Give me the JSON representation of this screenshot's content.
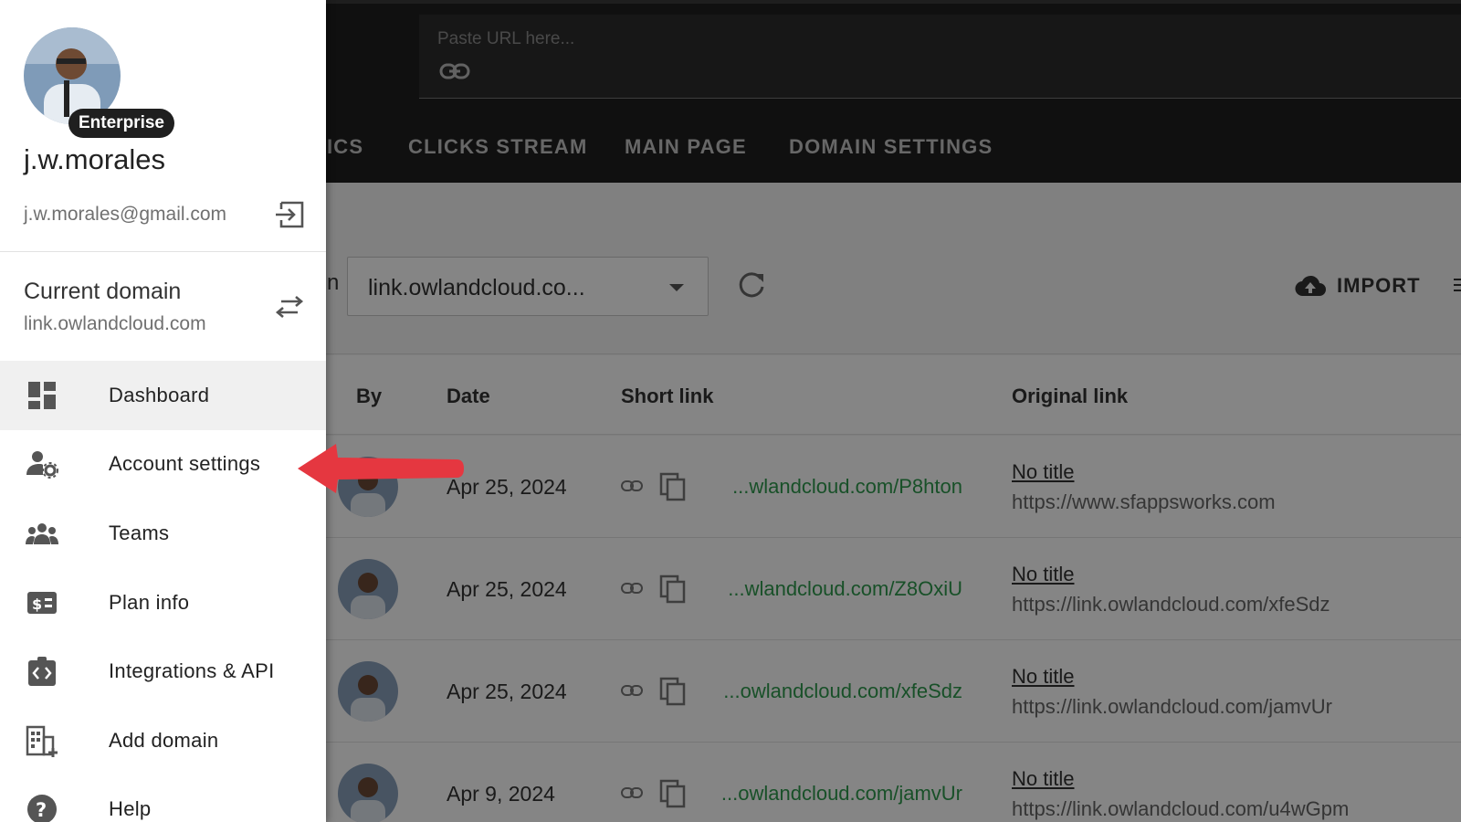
{
  "url_bar": {
    "placeholder": "Paste URL here..."
  },
  "tabs": [
    {
      "label": "ICS"
    },
    {
      "label": "CLICKS STREAM"
    },
    {
      "label": "MAIN PAGE"
    },
    {
      "label": "DOMAIN SETTINGS"
    }
  ],
  "toolbar": {
    "domain_select_value": "link.owlandcloud.co...",
    "partial_label": "n",
    "import_label": "IMPORT"
  },
  "table": {
    "headers": {
      "by": "By",
      "date": "Date",
      "short": "Short link",
      "original": "Original link"
    },
    "rows": [
      {
        "date": "Apr 25, 2024",
        "short": "...wlandcloud.com/P8hton",
        "title": "No title",
        "original": "https://www.sfappsworks.com"
      },
      {
        "date": "Apr 25, 2024",
        "short": "...wlandcloud.com/Z8OxiU",
        "title": "No title",
        "original": "https://link.owlandcloud.com/xfeSdz"
      },
      {
        "date": "Apr 25, 2024",
        "short": "...owlandcloud.com/xfeSdz",
        "title": "No title",
        "original": "https://link.owlandcloud.com/jamvUr"
      },
      {
        "date": "Apr 9, 2024",
        "short": "...owlandcloud.com/jamvUr",
        "title": "No title",
        "original": "https://link.owlandcloud.com/u4wGpm"
      }
    ]
  },
  "drawer": {
    "plan_badge": "Enterprise",
    "user_name": "j.w.morales",
    "user_email": "j.w.morales@gmail.com",
    "current_domain_label": "Current domain",
    "current_domain_value": "link.owlandcloud.com",
    "nav": [
      {
        "label": "Dashboard",
        "icon": "dashboard-icon",
        "active": true
      },
      {
        "label": "Account settings",
        "icon": "account-settings-icon",
        "active": false
      },
      {
        "label": "Teams",
        "icon": "teams-icon",
        "active": false
      },
      {
        "label": "Plan info",
        "icon": "plan-info-icon",
        "active": false
      },
      {
        "label": "Integrations & API",
        "icon": "integrations-icon",
        "active": false
      },
      {
        "label": "Add domain",
        "icon": "add-domain-icon",
        "active": false
      },
      {
        "label": "Help",
        "icon": "help-icon",
        "active": false
      }
    ]
  },
  "colors": {
    "topbar": "#202020",
    "short_link": "#2e9a4e",
    "pointer_arrow": "#e53740",
    "badge": "#1f1f1f"
  }
}
